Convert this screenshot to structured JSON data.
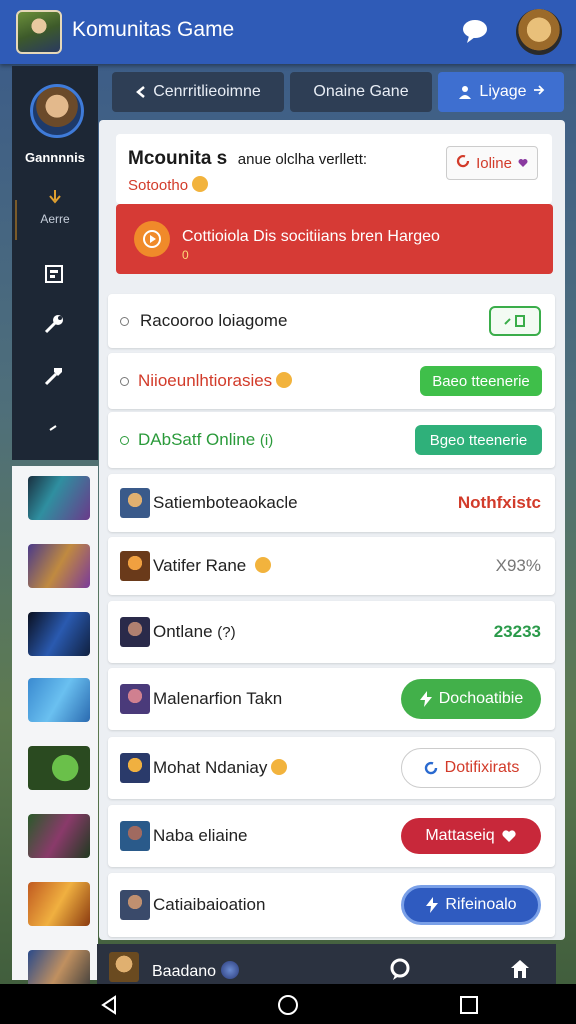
{
  "app": {
    "title": "Komunitas Game"
  },
  "sidebar": {
    "name": "Gannnnis",
    "sub": "Aerre"
  },
  "tabs": [
    {
      "label": "Cenrritlieoimne",
      "icon": "back-arrow-icon"
    },
    {
      "label": "Onaine Gane",
      "icon": ""
    },
    {
      "label": "Liyage",
      "icon": "user-sync-icon",
      "active": true
    }
  ],
  "notice": {
    "title_bold": "Mcounita s",
    "title_rest": "anue olclha verllett:",
    "subtitle": "Sotootho",
    "button": "Ioline"
  },
  "alert": {
    "text": "Cottioiola Dis socitiians bren Hargeo",
    "sub": "0"
  },
  "status_rows": [
    {
      "label": "Racooroo loiagome",
      "color": "#222222",
      "badge": "",
      "badge_style": "outline-green"
    },
    {
      "label": "Niioeunlhtiorasies",
      "color": "#d23b2a",
      "badge": "Baeo tteenerie",
      "badge_style": "green"
    },
    {
      "label": "DAbSatf Online",
      "color": "#2a9a3a",
      "badge": "Bgeo tteenerie",
      "badge_style": "teal"
    }
  ],
  "user_rows": [
    {
      "label": "Satiemboteaokacle",
      "value": "Nothfxistc",
      "value_color": "#d23b2a",
      "kind": "text"
    },
    {
      "label": "Vatifer Rane",
      "value": "X93%",
      "value_color": "#777777",
      "kind": "text"
    },
    {
      "label": "Ontlane",
      "value": "23233",
      "value_color": "#2a9a4a",
      "kind": "text"
    },
    {
      "label": "Malenarfion Takn",
      "value": "Dochoatibie",
      "kind": "btn-green"
    },
    {
      "label": "Mohat Ndaniay",
      "value": "Dotifixirats",
      "kind": "btn-outline"
    },
    {
      "label": "Naba eliaine",
      "value": "Mattaseiq",
      "kind": "btn-red"
    },
    {
      "label": "Catiaibaioation",
      "value": "Rifeinoalo",
      "kind": "btn-blue"
    }
  ],
  "bottom": {
    "label": "Baadano"
  }
}
